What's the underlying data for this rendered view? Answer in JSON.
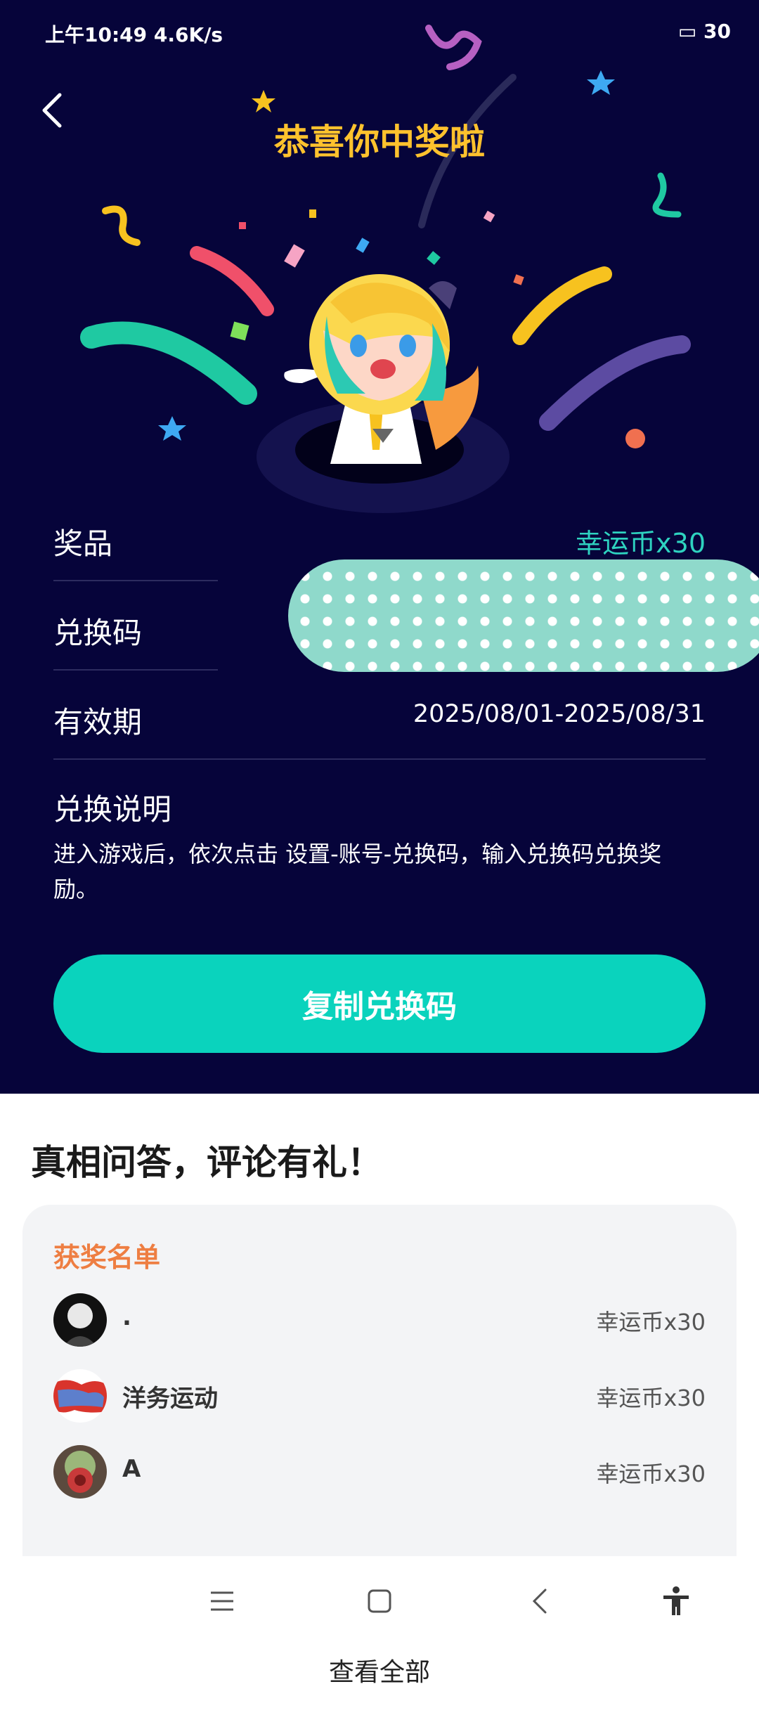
{
  "status": {
    "time": "上午10:49",
    "speed": "4.6K/s",
    "battery": "30"
  },
  "header": {
    "title": "恭喜你中奖啦"
  },
  "info": {
    "prize_label": "奖品",
    "prize_value": "幸运币x30",
    "code_label": "兑换码",
    "validity_label": "有效期",
    "validity_value": "2025/08/01-2025/08/31"
  },
  "instructions": {
    "title": "兑换说明",
    "text": "进入游戏后，依次点击 设置-账号-兑换码，输入兑换码兑换奖励。"
  },
  "copy_button": {
    "label": "复制兑换码"
  },
  "section": {
    "title": "真相问答，评论有礼！"
  },
  "winners": {
    "title": "获奖名单",
    "list": [
      {
        "name": ".",
        "prize": "幸运币x30"
      },
      {
        "name": "洋务运动",
        "prize": "幸运币x30"
      },
      {
        "name": "A",
        "prize": "幸运币x30"
      }
    ],
    "view_all": "查看全部"
  },
  "colors": {
    "bg_dark": "#06043a",
    "accent": "#0ad3bd",
    "title_gold": "#ffc22d",
    "winners_orange": "#ee7e42"
  }
}
